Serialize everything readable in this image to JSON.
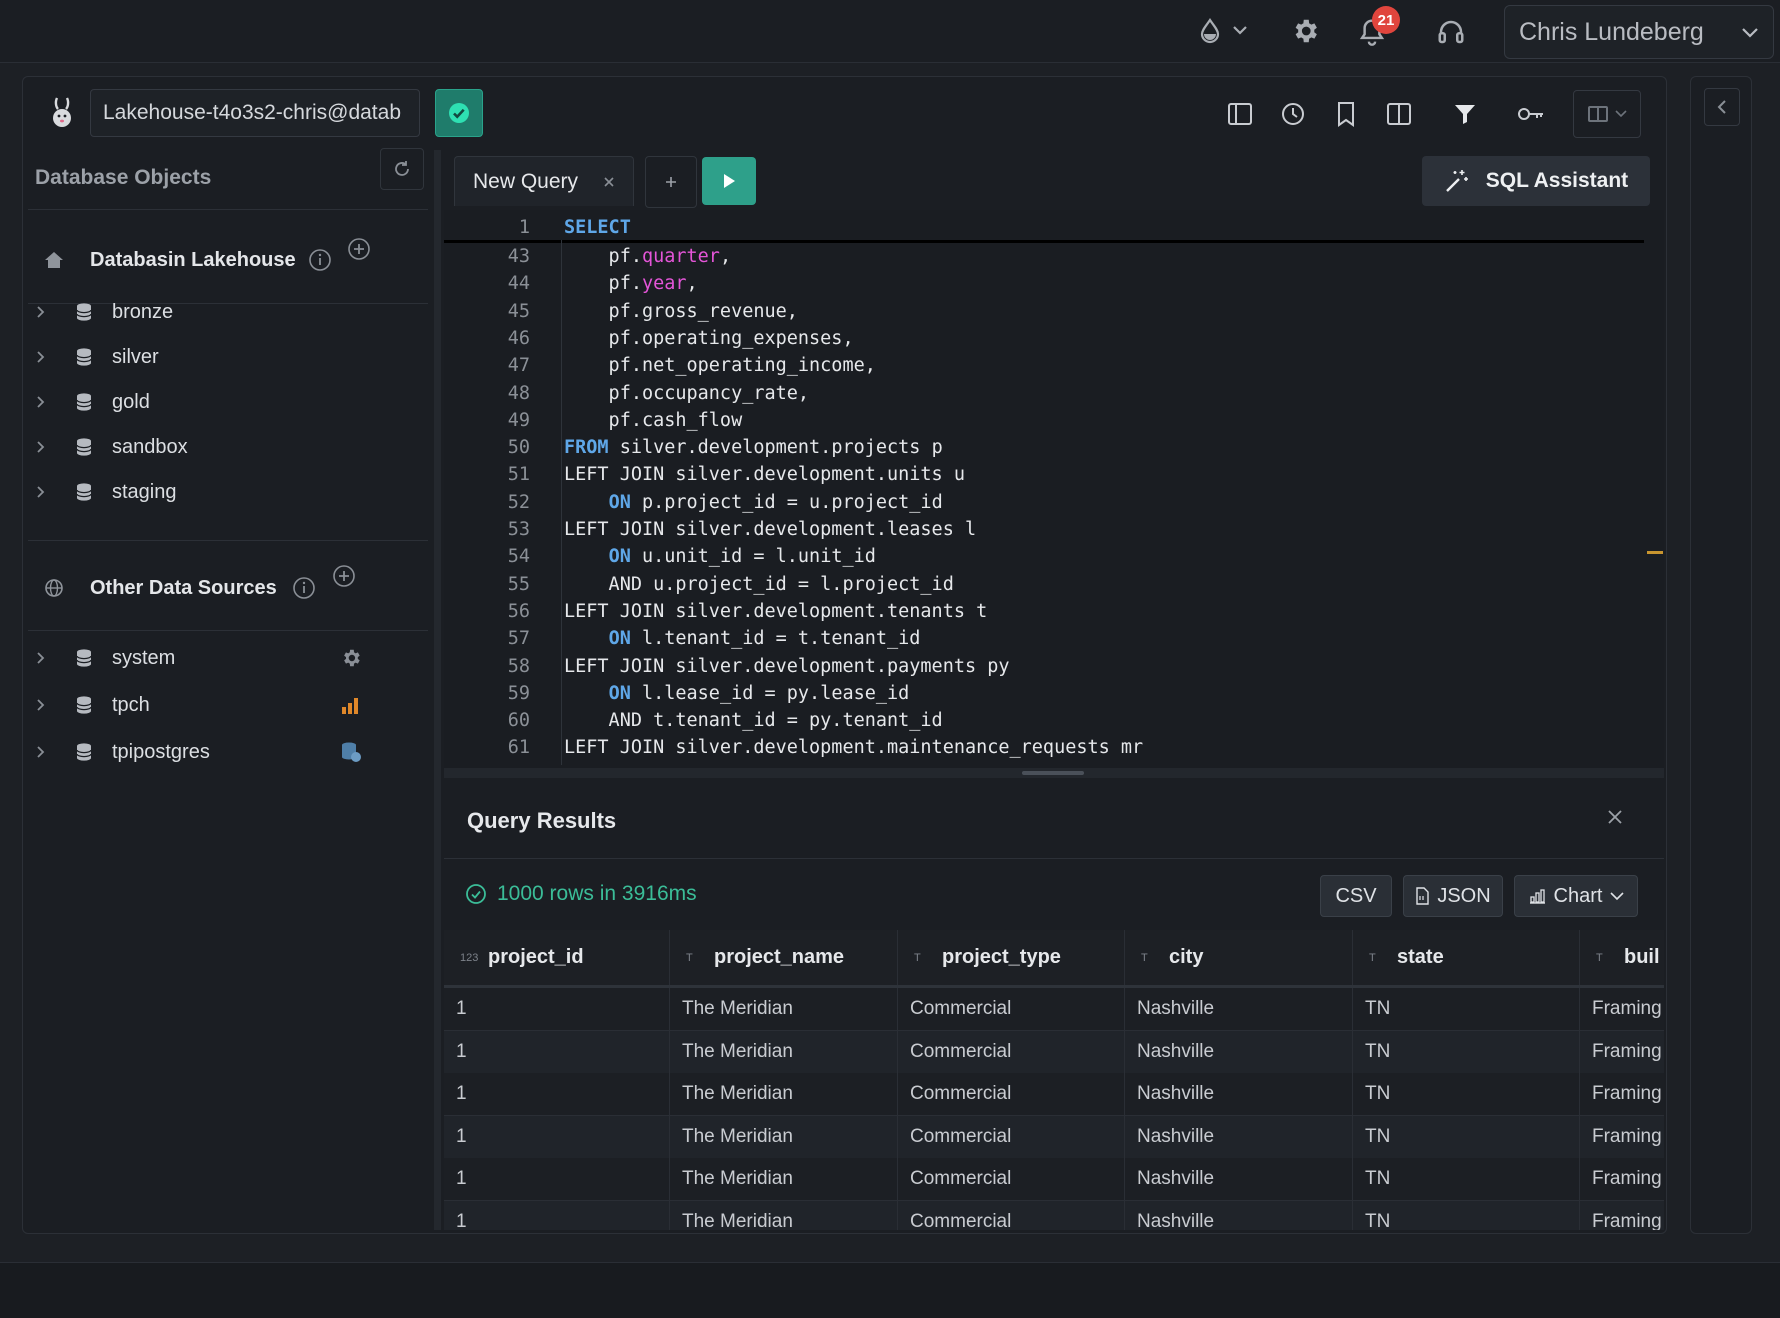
{
  "topbar": {
    "notification_count": "21",
    "user_name": "Chris Lundeberg"
  },
  "connection": {
    "value": "Lakehouse-t4o3s2-chris@datab"
  },
  "sidebar": {
    "title": "Database Objects",
    "lakehouse": {
      "label": "Databasin Lakehouse",
      "items": [
        {
          "label": "bronze"
        },
        {
          "label": "silver"
        },
        {
          "label": "gold"
        },
        {
          "label": "sandbox"
        },
        {
          "label": "staging"
        }
      ]
    },
    "other_sources": {
      "label": "Other Data Sources",
      "items": [
        {
          "label": "system",
          "icon": "gear-icon"
        },
        {
          "label": "tpch",
          "icon": "bar-chart-icon"
        },
        {
          "label": "tpipostgres",
          "icon": "database-icon"
        }
      ]
    }
  },
  "editor": {
    "tab_label": "New Query",
    "sql_assistant_label": "SQL Assistant",
    "lines": [
      {
        "n": "1",
        "segments": [
          {
            "t": "SELECT",
            "c": "kw"
          }
        ]
      },
      {
        "n": "43",
        "segments": [
          {
            "t": "    pf.",
            "c": ""
          },
          {
            "t": "quarter",
            "c": "pk"
          },
          {
            "t": ",",
            "c": ""
          }
        ]
      },
      {
        "n": "44",
        "segments": [
          {
            "t": "    pf.",
            "c": ""
          },
          {
            "t": "year",
            "c": "pk"
          },
          {
            "t": ",",
            "c": ""
          }
        ]
      },
      {
        "n": "45",
        "segments": [
          {
            "t": "    pf.gross_revenue,",
            "c": ""
          }
        ]
      },
      {
        "n": "46",
        "segments": [
          {
            "t": "    pf.operating_expenses,",
            "c": ""
          }
        ]
      },
      {
        "n": "47",
        "segments": [
          {
            "t": "    pf.net_operating_income,",
            "c": ""
          }
        ]
      },
      {
        "n": "48",
        "segments": [
          {
            "t": "    pf.occupancy_rate,",
            "c": ""
          }
        ]
      },
      {
        "n": "49",
        "segments": [
          {
            "t": "    pf.cash_flow",
            "c": ""
          }
        ]
      },
      {
        "n": "50",
        "segments": [
          {
            "t": "FROM",
            "c": "kw"
          },
          {
            "t": " silver.development.projects p",
            "c": ""
          }
        ]
      },
      {
        "n": "51",
        "segments": [
          {
            "t": "LEFT JOIN silver.development.units u",
            "c": ""
          }
        ]
      },
      {
        "n": "52",
        "segments": [
          {
            "t": "    ",
            "c": ""
          },
          {
            "t": "ON",
            "c": "kw"
          },
          {
            "t": " p.project_id = u.project_id",
            "c": ""
          }
        ]
      },
      {
        "n": "53",
        "segments": [
          {
            "t": "LEFT JOIN silver.development.leases l",
            "c": ""
          }
        ]
      },
      {
        "n": "54",
        "segments": [
          {
            "t": "    ",
            "c": ""
          },
          {
            "t": "ON",
            "c": "kw"
          },
          {
            "t": " u.unit_id = l.unit_id",
            "c": ""
          }
        ]
      },
      {
        "n": "55",
        "segments": [
          {
            "t": "    AND u.project_id = l.project_id",
            "c": ""
          }
        ]
      },
      {
        "n": "56",
        "segments": [
          {
            "t": "LEFT JOIN silver.development.tenants t",
            "c": ""
          }
        ]
      },
      {
        "n": "57",
        "segments": [
          {
            "t": "    ",
            "c": ""
          },
          {
            "t": "ON",
            "c": "kw"
          },
          {
            "t": " l.tenant_id = t.tenant_id",
            "c": ""
          }
        ]
      },
      {
        "n": "58",
        "segments": [
          {
            "t": "LEFT JOIN silver.development.payments py",
            "c": ""
          }
        ]
      },
      {
        "n": "59",
        "segments": [
          {
            "t": "    ",
            "c": ""
          },
          {
            "t": "ON",
            "c": "kw"
          },
          {
            "t": " l.lease_id = py.lease_id",
            "c": ""
          }
        ]
      },
      {
        "n": "60",
        "segments": [
          {
            "t": "    AND t.tenant_id = py.tenant_id",
            "c": ""
          }
        ]
      },
      {
        "n": "61",
        "segments": [
          {
            "t": "LEFT JOIN silver.development.maintenance_requests mr",
            "c": ""
          }
        ]
      }
    ]
  },
  "results": {
    "title": "Query Results",
    "status": "1000 rows in 3916ms",
    "csv_label": "CSV",
    "json_label": "JSON",
    "chart_label": "Chart",
    "columns": [
      {
        "type": "123",
        "name": "project_id"
      },
      {
        "type": "T",
        "name": "project_name"
      },
      {
        "type": "T",
        "name": "project_type"
      },
      {
        "type": "T",
        "name": "city"
      },
      {
        "type": "T",
        "name": "state"
      },
      {
        "type": "T",
        "name": "buil"
      }
    ],
    "rows": [
      [
        "1",
        "The Meridian",
        "Commercial",
        "Nashville",
        "TN",
        "Framing"
      ],
      [
        "1",
        "The Meridian",
        "Commercial",
        "Nashville",
        "TN",
        "Framing"
      ],
      [
        "1",
        "The Meridian",
        "Commercial",
        "Nashville",
        "TN",
        "Framing"
      ],
      [
        "1",
        "The Meridian",
        "Commercial",
        "Nashville",
        "TN",
        "Framing"
      ],
      [
        "1",
        "The Meridian",
        "Commercial",
        "Nashville",
        "TN",
        "Framing"
      ],
      [
        "1",
        "The Meridian",
        "Commercial",
        "Nashville",
        "TN",
        "Framing"
      ]
    ]
  },
  "colors": {
    "accent": "#2ea08a",
    "success": "#3bbd98",
    "keyword": "#5fa7e8",
    "identifier": "#e455d8",
    "badge": "#e0453d"
  }
}
